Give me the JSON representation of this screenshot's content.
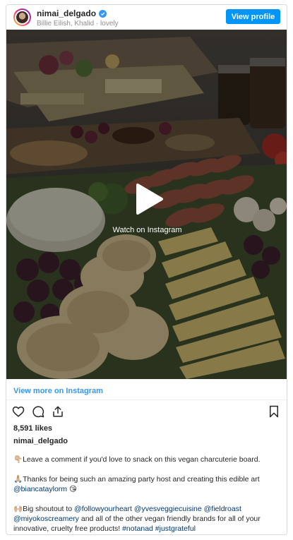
{
  "header": {
    "username": "nimai_delgado",
    "subtitle": "Billie Eilish, Khalid · lovely",
    "view_profile_label": "View profile"
  },
  "media": {
    "overlay_label": "Watch on Instagram"
  },
  "view_more_label": "View more on Instagram",
  "likes_label": "8,591 likes",
  "caption": {
    "username": "nimai_delgado",
    "line1": "👇🏼Leave a comment if you'd love to snack on this vegan charcuterie board.",
    "line2_text": "🙏🏼Thanks for being such an amazing party host and creating this edible art",
    "line2_mention": "@biancataylorm",
    "line2_emoji": " 😘",
    "line3_start": "🙌🏼Big shoutout to ",
    "mention1": "@followyourheart",
    "mention2": "@yvesveggiecuisine",
    "mention3": "@fieldroast",
    "mention4": "@miyokoscreamery",
    "line3_middle": " and all of the other vegan friendly brands for all of your innovative, cruelty free products! ",
    "hashtag1": "#notanad",
    "hashtag2": "#justgrateful"
  },
  "colors": {
    "accent": "#0095f6",
    "link": "#3897f0",
    "mention": "#00376b"
  },
  "icons": [
    "verified-badge-icon",
    "play-icon",
    "heart-icon",
    "comment-icon",
    "share-icon",
    "bookmark-icon"
  ]
}
